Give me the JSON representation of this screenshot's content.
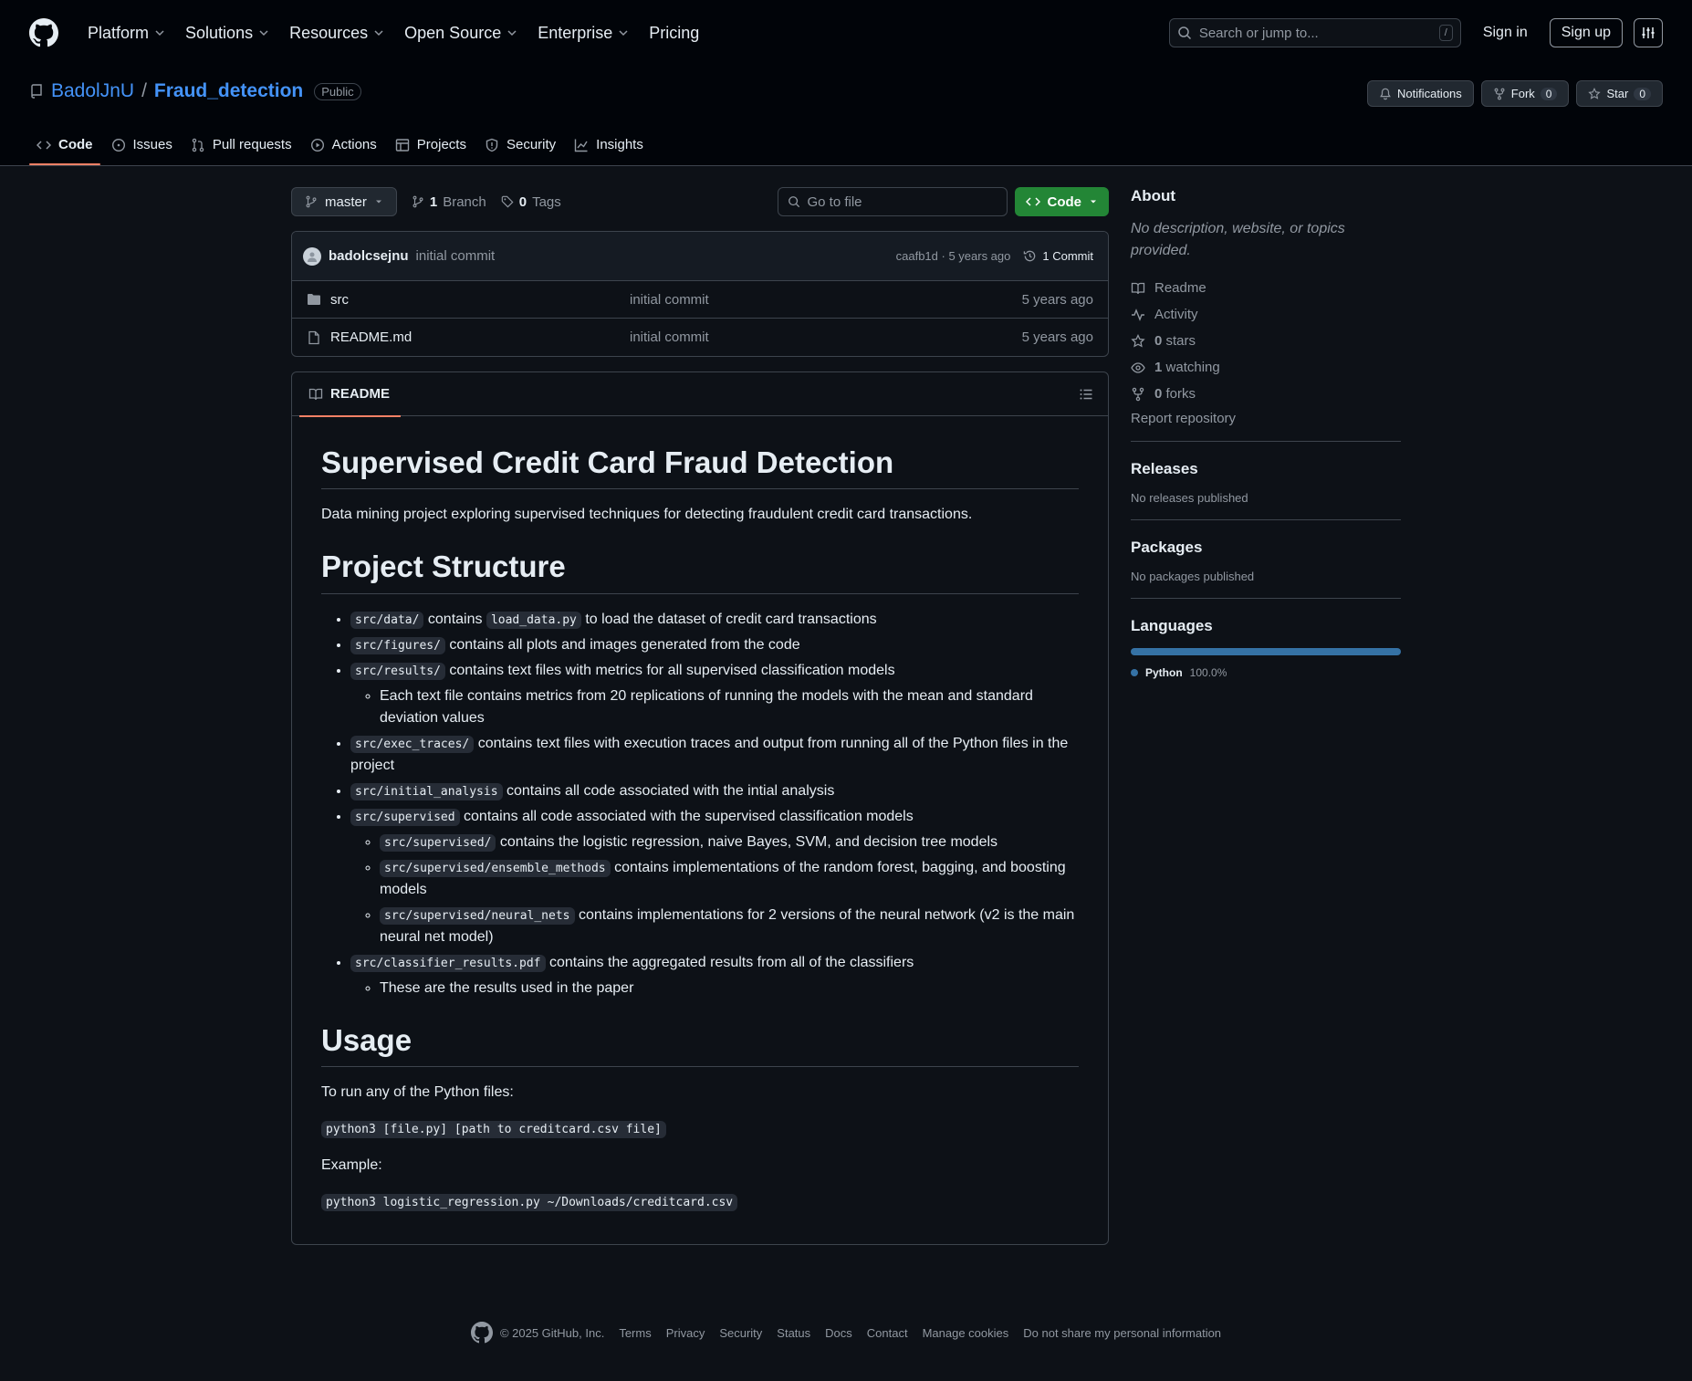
{
  "header": {
    "nav": [
      "Platform",
      "Solutions",
      "Resources",
      "Open Source",
      "Enterprise",
      "Pricing"
    ],
    "search_placeholder": "Search or jump to...",
    "search_shortcut": "/",
    "sign_in": "Sign in",
    "sign_up": "Sign up"
  },
  "repo": {
    "owner": "BadolJnU",
    "separator": "/",
    "name": "Fraud_detection",
    "visibility": "Public",
    "notifications": "Notifications",
    "fork_label": "Fork",
    "fork_count": "0",
    "star_label": "Star",
    "star_count": "0",
    "tabs": [
      "Code",
      "Issues",
      "Pull requests",
      "Actions",
      "Projects",
      "Security",
      "Insights"
    ]
  },
  "toolbar": {
    "branch": "master",
    "branch_count": "1",
    "branch_label": "Branch",
    "tag_count": "0",
    "tag_label": "Tags",
    "goto_placeholder": "Go to file",
    "code_button": "Code"
  },
  "commit": {
    "author": "badolcsejnu",
    "message": "initial commit",
    "hash_time": "caafb1d · 5 years ago",
    "commits_link": "1 Commit"
  },
  "files": [
    {
      "name": "src",
      "type": "folder",
      "commit": "initial commit",
      "time": "5 years ago"
    },
    {
      "name": "README.md",
      "type": "file",
      "commit": "initial commit",
      "time": "5 years ago"
    }
  ],
  "readme": {
    "tab": "README",
    "h1": "Supervised Credit Card Fraud Detection",
    "intro": "Data mining project exploring supervised techniques for detecting fraudulent credit card transactions.",
    "h_structure": "Project Structure",
    "items": {
      "data_code": "src/data/",
      "data_mid": "contains",
      "data_code2": "load_data.py",
      "data_text": "to load the dataset of credit card transactions",
      "figures_code": "src/figures/",
      "figures_text": "contains all plots and images generated from the code",
      "results_code": "src/results/",
      "results_text": "contains text files with metrics for all supervised classification models",
      "results_sub": "Each text file contains metrics from 20 replications of running the models with the mean and standard deviation values",
      "exec_code": "src/exec_traces/",
      "exec_text": "contains text files with execution traces and output from running all of the Python files in the project",
      "initial_code": "src/initial_analysis",
      "initial_text": "contains all code associated with the intial analysis",
      "sup_code": "src/supervised",
      "sup_text": "contains all code associated with the supervised classification models",
      "sup1_code": "src/supervised/",
      "sup1_text": "contains the logistic regression, naive Bayes, SVM, and decision tree models",
      "sup2_code": "src/supervised/ensemble_methods",
      "sup2_text": "contains implementations of the random forest, bagging, and boosting models",
      "sup3_code": "src/supervised/neural_nets",
      "sup3_text": "contains implementations for 2 versions of the neural network (v2 is the main neural net model)",
      "clf_code": "src/classifier_results.pdf",
      "clf_text": "contains the aggregated results from all of the classifiers",
      "clf_sub": "These are the results used in the paper"
    },
    "h_usage": "Usage",
    "usage_text": "To run any of the Python files:",
    "usage_cmd": "python3 [file.py] [path to creditcard.csv file]",
    "example_label": "Example:",
    "example_cmd": "python3 logistic_regression.py ~/Downloads/creditcard.csv"
  },
  "about": {
    "title": "About",
    "description": "No description, website, or topics provided.",
    "readme": "Readme",
    "activity": "Activity",
    "stars_count": "0",
    "stars_label": "stars",
    "watching_count": "1",
    "watching_label": "watching",
    "forks_count": "0",
    "forks_label": "forks",
    "report": "Report repository"
  },
  "releases": {
    "title": "Releases",
    "note": "No releases published"
  },
  "packages": {
    "title": "Packages",
    "note": "No packages published"
  },
  "languages": {
    "title": "Languages",
    "name": "Python",
    "percent": "100.0%",
    "share": 1.0,
    "color": "#3572A5"
  },
  "footer": {
    "copyright": "© 2025 GitHub, Inc.",
    "links": [
      "Terms",
      "Privacy",
      "Security",
      "Status",
      "Docs",
      "Contact",
      "Manage cookies",
      "Do not share my personal information"
    ]
  }
}
